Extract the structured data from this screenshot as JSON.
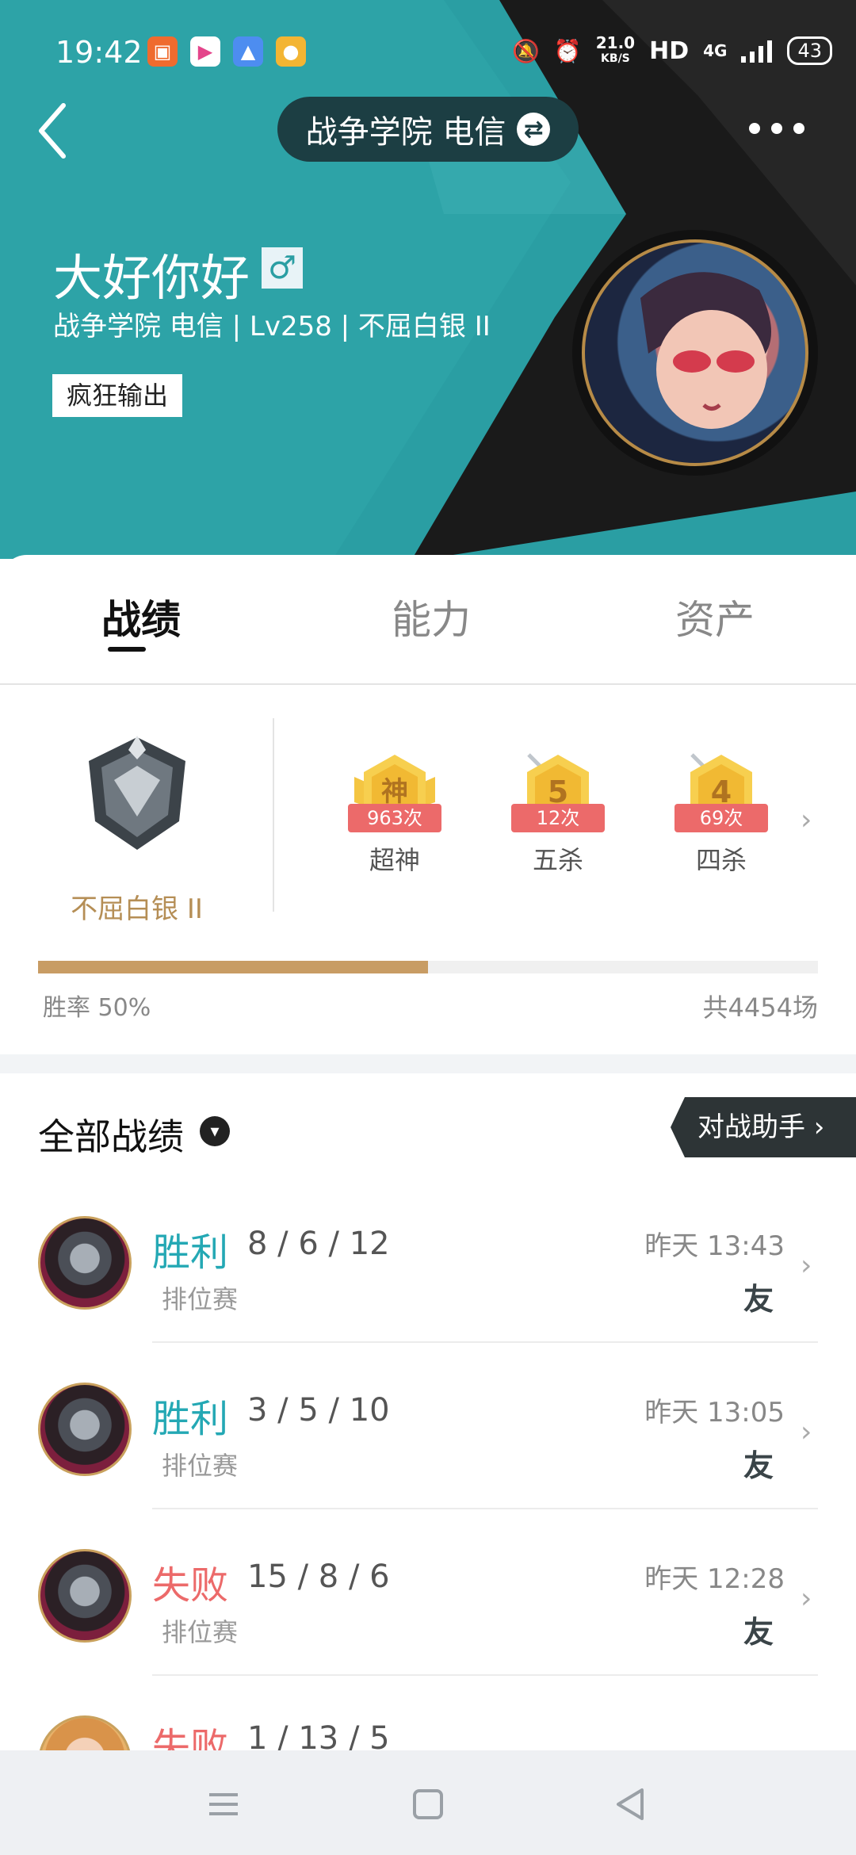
{
  "status_bar": {
    "time": "19:42",
    "net_speed_value": "21.0",
    "net_speed_unit": "KB/S",
    "hd": "HD",
    "network": "4G",
    "battery": "43"
  },
  "top_bar": {
    "server": "战争学院 电信"
  },
  "profile": {
    "name": "大好你好",
    "gender_symbol": "♂",
    "meta": "战争学院 电信 | Lv258 | 不屈白银 II",
    "tag": "疯狂输出"
  },
  "tabs": [
    {
      "label": "战绩",
      "active": true
    },
    {
      "label": "能力",
      "active": false
    },
    {
      "label": "资产",
      "active": false
    }
  ],
  "rank": {
    "name": "不屈白银 II"
  },
  "honors": [
    {
      "symbol": "神",
      "count": "963次",
      "label": "超神"
    },
    {
      "symbol": "5",
      "count": "12次",
      "label": "五杀"
    },
    {
      "symbol": "4",
      "count": "69次",
      "label": "四杀"
    }
  ],
  "stats": {
    "win_rate_label": "胜率  50%",
    "win_rate": 0.5,
    "total": "共4454场"
  },
  "match_list": {
    "title": "全部战绩",
    "assistant": "对战助手 ›",
    "matches": [
      {
        "result": "胜利",
        "kda": "8 / 6 / 12",
        "mode": "排位赛",
        "time": "昨天 13:43",
        "badge": "友"
      },
      {
        "result": "胜利",
        "kda": "3 / 5 / 10",
        "mode": "排位赛",
        "time": "昨天 13:05",
        "badge": "友"
      },
      {
        "result": "失败",
        "kda": "15 / 8 / 6",
        "mode": "排位赛",
        "time": "昨天 12:28",
        "badge": "友"
      },
      {
        "result": "失败",
        "kda": "1 / 13 / 5"
      }
    ]
  },
  "colors": {
    "header_teal": "#2a9ea3",
    "win": "#24a8b4",
    "lose": "#ec6a6a",
    "gold": "#c89c64"
  }
}
